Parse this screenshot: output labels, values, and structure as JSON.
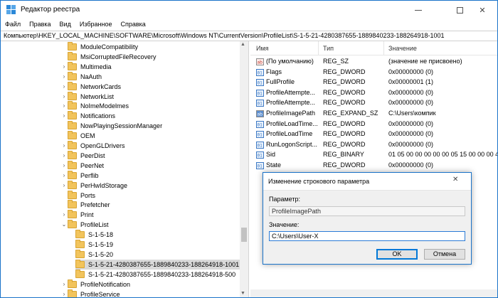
{
  "window": {
    "title": "Редактор реестра"
  },
  "menu": [
    "Файл",
    "Правка",
    "Вид",
    "Избранное",
    "Справка"
  ],
  "address": "Компьютер\\HKEY_LOCAL_MACHINE\\SOFTWARE\\Microsoft\\Windows NT\\CurrentVersion\\ProfileList\\S-1-5-21-4280387655-1889840233-188264918-1001",
  "tree": [
    {
      "label": "ModuleCompatibility",
      "level": 0
    },
    {
      "label": "MsiCorruptedFileRecovery",
      "level": 0
    },
    {
      "label": "Multimedia",
      "level": 0,
      "caret": "›"
    },
    {
      "label": "NaAuth",
      "level": 0,
      "caret": "›"
    },
    {
      "label": "NetworkCards",
      "level": 0,
      "caret": "›"
    },
    {
      "label": "NetworkList",
      "level": 0,
      "caret": "›"
    },
    {
      "label": "NoImeModelmes",
      "level": 0,
      "caret": "›"
    },
    {
      "label": "Notifications",
      "level": 0,
      "caret": "›"
    },
    {
      "label": "NowPlayingSessionManager",
      "level": 0
    },
    {
      "label": "OEM",
      "level": 0
    },
    {
      "label": "OpenGLDrivers",
      "level": 0,
      "caret": "›"
    },
    {
      "label": "PeerDist",
      "level": 0,
      "caret": "›"
    },
    {
      "label": "PeerNet",
      "level": 0,
      "caret": "›"
    },
    {
      "label": "Perflib",
      "level": 0,
      "caret": "›"
    },
    {
      "label": "PerHwIdStorage",
      "level": 0,
      "caret": "›"
    },
    {
      "label": "Ports",
      "level": 0
    },
    {
      "label": "Prefetcher",
      "level": 0
    },
    {
      "label": "Print",
      "level": 0,
      "caret": "›"
    },
    {
      "label": "ProfileList",
      "level": 0,
      "caret": "⌄"
    },
    {
      "label": "S-1-5-18",
      "level": 1
    },
    {
      "label": "S-1-5-19",
      "level": 1
    },
    {
      "label": "S-1-5-20",
      "level": 1
    },
    {
      "label": "S-1-5-21-4280387655-1889840233-188264918-1001",
      "level": 1,
      "selected": true
    },
    {
      "label": "S-1-5-21-4280387655-1889840233-188264918-500",
      "level": 1
    },
    {
      "label": "ProfileNotification",
      "level": 0,
      "caret": "›"
    },
    {
      "label": "ProfileService",
      "level": 0,
      "caret": "›"
    }
  ],
  "list": {
    "headers": {
      "name": "Имя",
      "type": "Тип",
      "value": "Значение"
    },
    "rows": [
      {
        "name": "(По умолчанию)",
        "type": "REG_SZ",
        "value": "(значение не присвоено)",
        "kind": "sz"
      },
      {
        "name": "Flags",
        "type": "REG_DWORD",
        "value": "0x00000000 (0)",
        "kind": "bin"
      },
      {
        "name": "FullProfile",
        "type": "REG_DWORD",
        "value": "0x00000001 (1)",
        "kind": "bin"
      },
      {
        "name": "ProfileAttempte...",
        "type": "REG_DWORD",
        "value": "0x00000000 (0)",
        "kind": "bin"
      },
      {
        "name": "ProfileAttempte...",
        "type": "REG_DWORD",
        "value": "0x00000000 (0)",
        "kind": "bin"
      },
      {
        "name": "ProfileImagePath",
        "type": "REG_EXPAND_SZ",
        "value": "C:\\Users\\компик",
        "kind": "sz-sel"
      },
      {
        "name": "ProfileLoadTime...",
        "type": "REG_DWORD",
        "value": "0x00000000 (0)",
        "kind": "bin"
      },
      {
        "name": "ProfileLoadTime",
        "type": "REG_DWORD",
        "value": "0x00000000 (0)",
        "kind": "bin"
      },
      {
        "name": "RunLogonScript...",
        "type": "REG_DWORD",
        "value": "0x00000000 (0)",
        "kind": "bin"
      },
      {
        "name": "Sid",
        "type": "REG_BINARY",
        "value": "01 05 00 00 00 00 00 05 15 00 00 00 47 8",
        "kind": "bin"
      },
      {
        "name": "State",
        "type": "REG_DWORD",
        "value": "0x00000000 (0)",
        "kind": "bin"
      }
    ]
  },
  "dialog": {
    "title": "Изменение строкового параметра",
    "param_label": "Параметр:",
    "param_value": "ProfileImagePath",
    "value_label": "Значение:",
    "value_input": "C:\\Users\\User-X",
    "ok": "OK",
    "cancel": "Отмена"
  },
  "colors": {
    "folder": "#f2c45c",
    "accent": "#0078d7",
    "selected": "#d9d9d9"
  }
}
